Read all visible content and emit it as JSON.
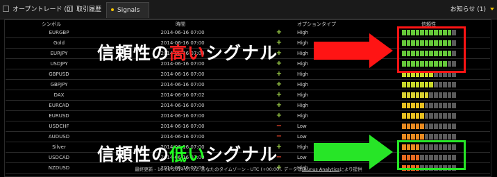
{
  "tabs": [
    {
      "label": "オープントレード (0)"
    },
    {
      "label": "取引履歴"
    },
    {
      "label": "Signals"
    }
  ],
  "notice": {
    "label": "お知らせ (1)"
  },
  "table": {
    "headers": {
      "symbol": "シンボル",
      "time": "時間",
      "option_type": "オプションタイプ",
      "reliability": "信頼性"
    },
    "rows": [
      {
        "symbol": "EURGBP",
        "time": "2014-06-16 07:00",
        "dir": "+",
        "type": "High",
        "level": 0.9,
        "color": "#66c93a"
      },
      {
        "symbol": "Gold",
        "time": "2014-06-16 07:00",
        "dir": "+",
        "type": "High",
        "level": 0.9,
        "color": "#66c93a"
      },
      {
        "symbol": "EURJPY",
        "time": "2014-06-16 07:00",
        "dir": "+",
        "type": "High",
        "level": 0.9,
        "color": "#66c93a"
      },
      {
        "symbol": "USDJPY",
        "time": "2014-06-16 07:00",
        "dir": "+",
        "type": "High",
        "level": 0.85,
        "color": "#66c93a"
      },
      {
        "symbol": "GBPUSD",
        "time": "2014-06-16 07:00",
        "dir": "+",
        "type": "High",
        "level": 0.55,
        "color": "#c8d82a"
      },
      {
        "symbol": "GBPJPY",
        "time": "2014-06-16 07:00",
        "dir": "+",
        "type": "High",
        "level": 0.55,
        "color": "#c8d82a"
      },
      {
        "symbol": "DAX",
        "time": "2014-06-16 07:02",
        "dir": "+",
        "type": "High",
        "level": 0.5,
        "color": "#d8d030"
      },
      {
        "symbol": "EURCAD",
        "time": "2014-06-16 07:00",
        "dir": "+",
        "type": "High",
        "level": 0.45,
        "color": "#e8c020"
      },
      {
        "symbol": "EURUSD",
        "time": "2014-06-16 07:00",
        "dir": "+",
        "type": "High",
        "level": 0.45,
        "color": "#e8c020"
      },
      {
        "symbol": "USDCHF",
        "time": "2014-06-16 07:00",
        "dir": "−",
        "type": "Low",
        "level": 0.4,
        "color": "#e88a20"
      },
      {
        "symbol": "AUDUSD",
        "time": "2014-06-16 07:00",
        "dir": "−",
        "type": "Low",
        "level": 0.4,
        "color": "#e88a20"
      },
      {
        "symbol": "Silver",
        "time": "2014-06-16 07:00",
        "dir": "+",
        "type": "High",
        "level": 0.35,
        "color": "#e88a20"
      },
      {
        "symbol": "USDCAD",
        "time": "2014-06-16 07:00",
        "dir": "−",
        "type": "Low",
        "level": 0.3,
        "color": "#e86a20"
      },
      {
        "symbol": "NZDUSD",
        "time": "2014-06-16 07:00",
        "dir": "+",
        "type": "High",
        "level": 0.3,
        "color": "#e86a20"
      }
    ]
  },
  "footer": {
    "text": "最終更新 - 16-06-2014 07:02, あなたのタイムゾーン - UTC (+00:00). データは",
    "link": "Faunus Analytics",
    "suffix": "により提供"
  },
  "overlay": {
    "high": {
      "prefix": "信頼性の",
      "emph": "高い",
      "suffix": "シグナル"
    },
    "low": {
      "prefix": "信頼性の",
      "emph": "低い",
      "suffix": "シグナル"
    }
  },
  "colors": {
    "accent": "#f2c200",
    "plus": "#9fd14a",
    "minus": "#e5452c",
    "high_box": "#ff1414",
    "low_box": "#27e527",
    "high_text": "#ff2020",
    "low_text": "#22ff22"
  }
}
